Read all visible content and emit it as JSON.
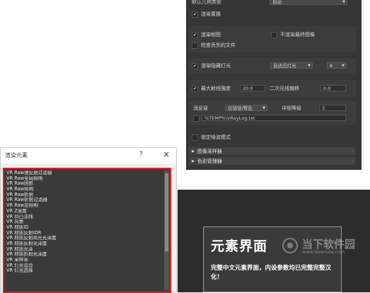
{
  "vray_panel": {
    "top_row": {
      "label": "默认几何类型",
      "value": "自动"
    },
    "render_replace": {
      "label": "渲染置换",
      "checked": true
    },
    "render_thumbnail": {
      "label": "渲染帧图",
      "checked": true
    },
    "no_render_final": {
      "label": "不渲染最终图像",
      "checked": false
    },
    "check_missing_files": {
      "label": "检查丢失的文件",
      "checked": false
    },
    "hidden_lights": {
      "label": "渲染隐藏灯光",
      "checked": true,
      "mode": "自适应灯光",
      "count": "8"
    },
    "max_ray_intensity": {
      "label": "最大射线强度",
      "checked": true,
      "value": "20.0"
    },
    "secondary_ray_bias": {
      "label": "二次光线偏移",
      "value": "0.0"
    },
    "log": {
      "label": "消息窗",
      "level_mode": "仅错误/警告",
      "detail_label": "详细等级",
      "detail_value": "3",
      "path": "%TEMP%\\VRayLog.txt"
    },
    "lock_noise": {
      "label": "锁定噪波模式",
      "checked": false
    },
    "rollouts": [
      "图像采样器",
      "色彩管理器"
    ]
  },
  "render_elements": {
    "title": "渲染元素",
    "help": "?",
    "close": "×",
    "items": [
      "VR Raw漫反射过滤器",
      "VR Raw全局照明",
      "VR Raw阴影",
      "VR Raw照明",
      "VR Raw折射",
      "VR Raw折射过滤器",
      "VR Raw总照明",
      "VR Z深度",
      "VR 凹凸法线",
      "VR 背景",
      "VR 材质ID",
      "VR 材质反射IOR",
      "VR 材质反射高光光泽度",
      "VR 材质反射光泽度",
      "VR 材质光泽",
      "VR 材质折射光泽度",
      "VR 采样率",
      "VR 灯光混合",
      "VR 灯光选择"
    ]
  },
  "caption": {
    "heading": "元素界面",
    "text": "完整中文元素界面，内设参数均已完整完整汉化！",
    "watermark_name": "当下软件园",
    "watermark_url": "www.downxia.com"
  }
}
